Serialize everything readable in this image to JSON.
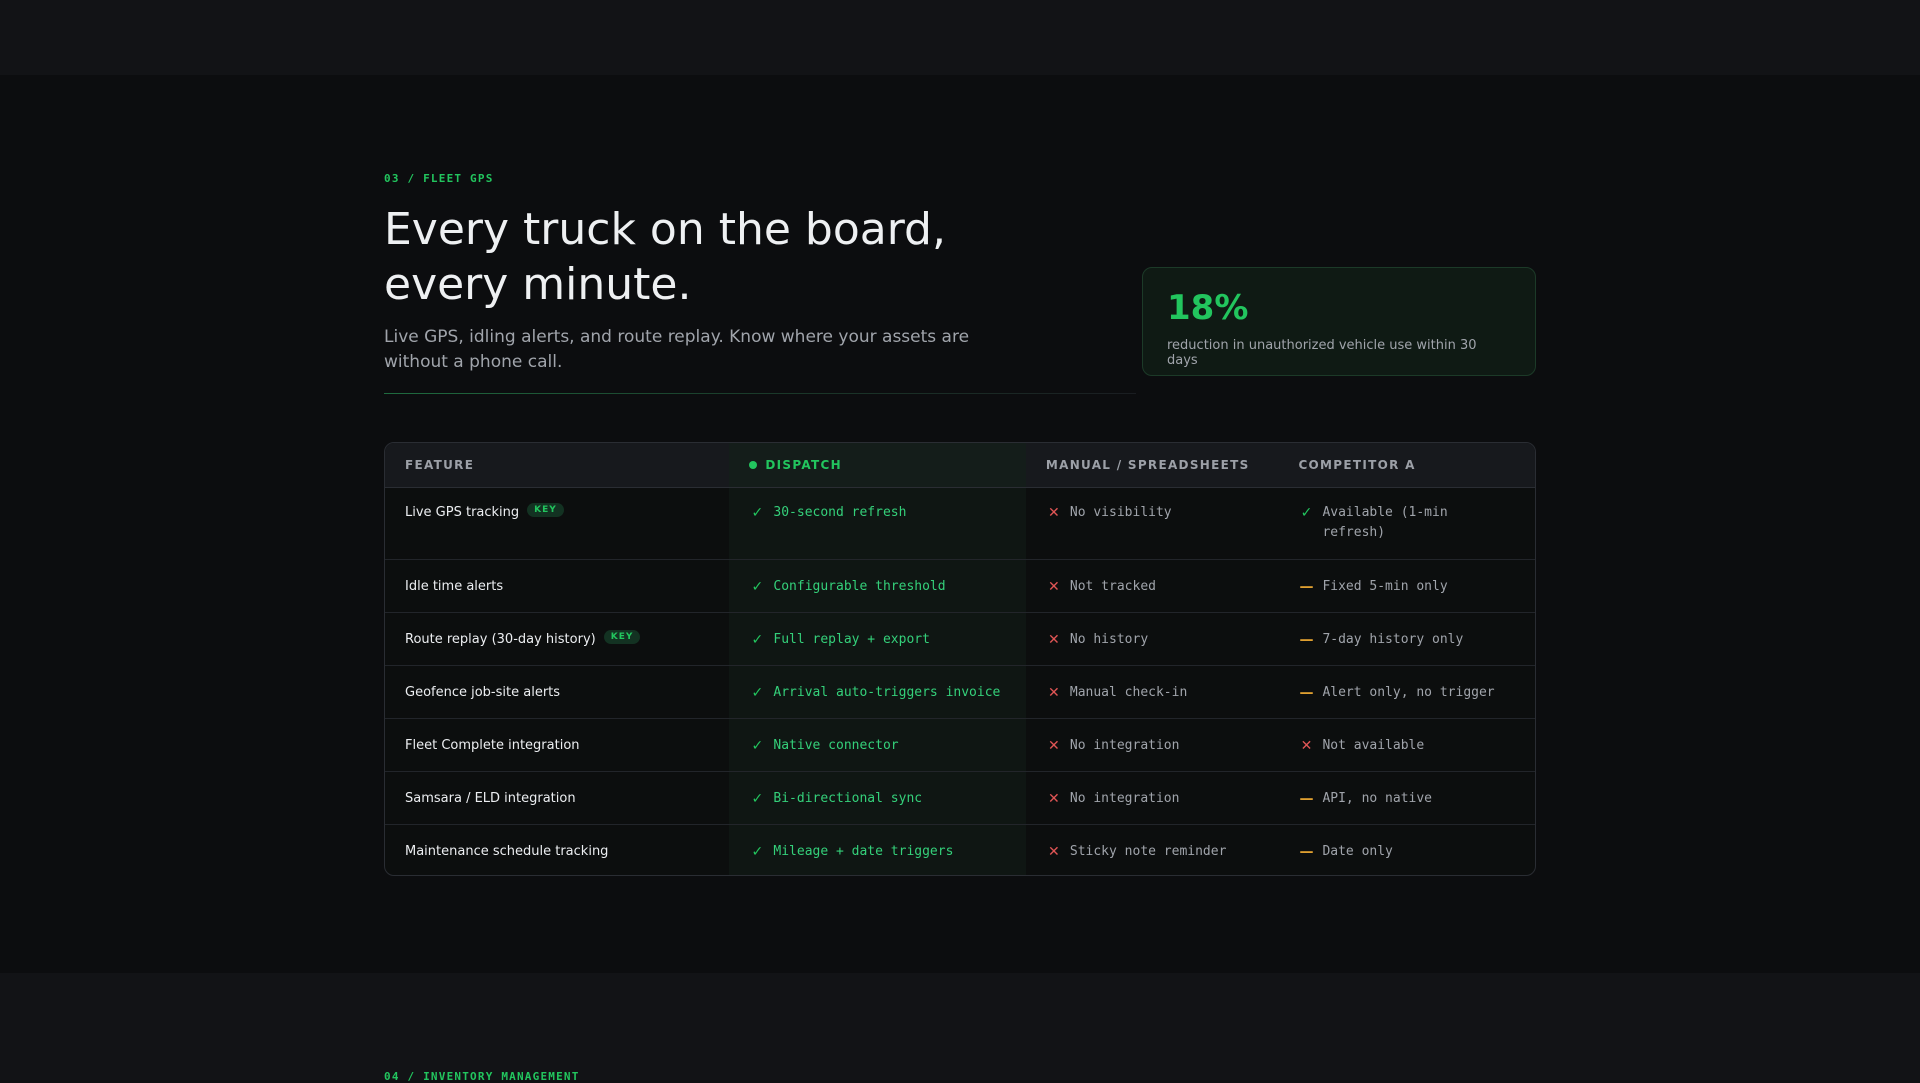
{
  "section": {
    "eyebrow": "03 / FLEET GPS",
    "headline_line1": "Every truck on the board,",
    "headline_line2": "every minute.",
    "subhead": "Live GPS, idling alerts, and route replay. Know where your assets are without a phone call."
  },
  "stat": {
    "value": "18%",
    "label": "reduction in unauthorized vehicle use within 30 days"
  },
  "table": {
    "headers": [
      "FEATURE",
      "DISPATCH",
      "MANUAL / SPREADSHEETS",
      "COMPETITOR A"
    ],
    "rows": [
      {
        "feature": "Live GPS tracking",
        "badge": "KEY",
        "dispatch": "30-second refresh",
        "manual": "No visibility",
        "manual_mark": "x",
        "competitor": "Available (1-min refresh)",
        "competitor_mark": "check"
      },
      {
        "feature": "Idle time alerts",
        "badge": "",
        "dispatch": "Configurable threshold",
        "manual": "Not tracked",
        "manual_mark": "x",
        "competitor": "Fixed 5-min only",
        "competitor_mark": "dash"
      },
      {
        "feature": "Route replay (30-day history)",
        "badge": "KEY",
        "dispatch": "Full replay + export",
        "manual": "No history",
        "manual_mark": "x",
        "competitor": "7-day history only",
        "competitor_mark": "dash"
      },
      {
        "feature": "Geofence job-site alerts",
        "badge": "",
        "dispatch": "Arrival auto-triggers invoice",
        "manual": "Manual check-in",
        "manual_mark": "x",
        "competitor": "Alert only, no trigger",
        "competitor_mark": "dash"
      },
      {
        "feature": "Fleet Complete integration",
        "badge": "",
        "dispatch": "Native connector",
        "manual": "No integration",
        "manual_mark": "x",
        "competitor": "Not available",
        "competitor_mark": "x"
      },
      {
        "feature": "Samsara / ELD integration",
        "badge": "",
        "dispatch": "Bi-directional sync",
        "manual": "No integration",
        "manual_mark": "x",
        "competitor": "API, no native",
        "competitor_mark": "dash"
      },
      {
        "feature": "Maintenance schedule tracking",
        "badge": "",
        "dispatch": "Mileage + date triggers",
        "manual": "Sticky note reminder",
        "manual_mark": "x",
        "competitor": "Date only",
        "competitor_mark": "dash"
      }
    ]
  },
  "next_section": {
    "eyebrow": "04 / INVENTORY MANAGEMENT"
  },
  "colors": {
    "accent": "#22c55e",
    "negative": "#e05555",
    "partial": "#e0a030"
  }
}
